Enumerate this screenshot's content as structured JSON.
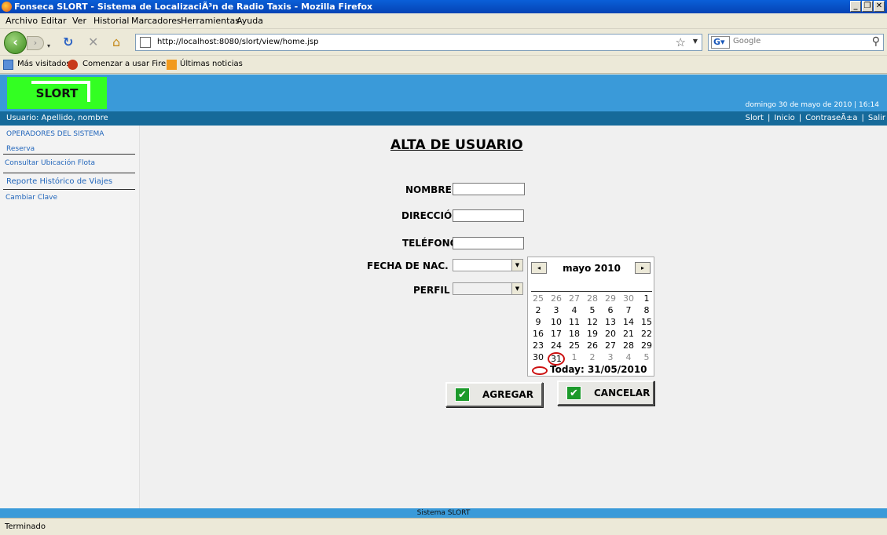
{
  "window": {
    "title": "Fonseca SLORT - Sistema de LocalizaciÃ³n de Radio Taxis - Mozilla Firefox",
    "controls": [
      "_",
      "❐",
      "✕"
    ]
  },
  "menu": [
    "Archivo",
    "Editar",
    "Ver",
    "Historial",
    "Marcadores",
    "Herramientas",
    "Ayuda"
  ],
  "nav": {
    "url": "http://localhost:8080/slort/view/home.jsp",
    "search_placeholder": "Google"
  },
  "bookmarks": [
    "Más visitados",
    "Comenzar a usar Fire...",
    "Últimas noticias"
  ],
  "header": {
    "logo_text": "SLORT",
    "datetime": "domingo 30 de mayo de 2010 | 16:14"
  },
  "userbar": {
    "user": "Usuario: Apellido, nombre",
    "links": [
      "Slort",
      "Inicio",
      "ContraseÃ±a",
      "Salir"
    ]
  },
  "sidebar": {
    "section": "OPERADORES DEL SISTEMA",
    "items": [
      "Reserva",
      "Consultar Ubicación Flota",
      "Reporte Histórico de Viajes",
      "Cambiar Clave"
    ]
  },
  "form": {
    "title": "ALTA DE USUARIO",
    "labels": {
      "nombre": "NOMBRE",
      "direccion": "DIRECCIÓN",
      "telefono": "TELÉFONO",
      "fecha": "FECHA DE NAC.",
      "perfil": "PERFIL"
    },
    "values": {
      "nombre": "",
      "direccion": "",
      "telefono": ""
    }
  },
  "calendar": {
    "month_label": "mayo 2010",
    "prev": "◂",
    "next": "▸",
    "weeks": [
      [
        "25",
        "26",
        "27",
        "28",
        "29",
        "30",
        "1"
      ],
      [
        "2",
        "3",
        "4",
        "5",
        "6",
        "7",
        "8"
      ],
      [
        "9",
        "10",
        "11",
        "12",
        "13",
        "14",
        "15"
      ],
      [
        "16",
        "17",
        "18",
        "19",
        "20",
        "21",
        "22"
      ],
      [
        "23",
        "24",
        "25",
        "26",
        "27",
        "28",
        "29"
      ],
      [
        "30",
        "31",
        "1",
        "2",
        "3",
        "4",
        "5"
      ]
    ],
    "today_text": "Today: 31/05/2010"
  },
  "buttons": {
    "add": "AGREGAR",
    "cancel": "CANCELAR",
    "check": "✔"
  },
  "footer": "Sistema SLORT",
  "status": "Terminado"
}
